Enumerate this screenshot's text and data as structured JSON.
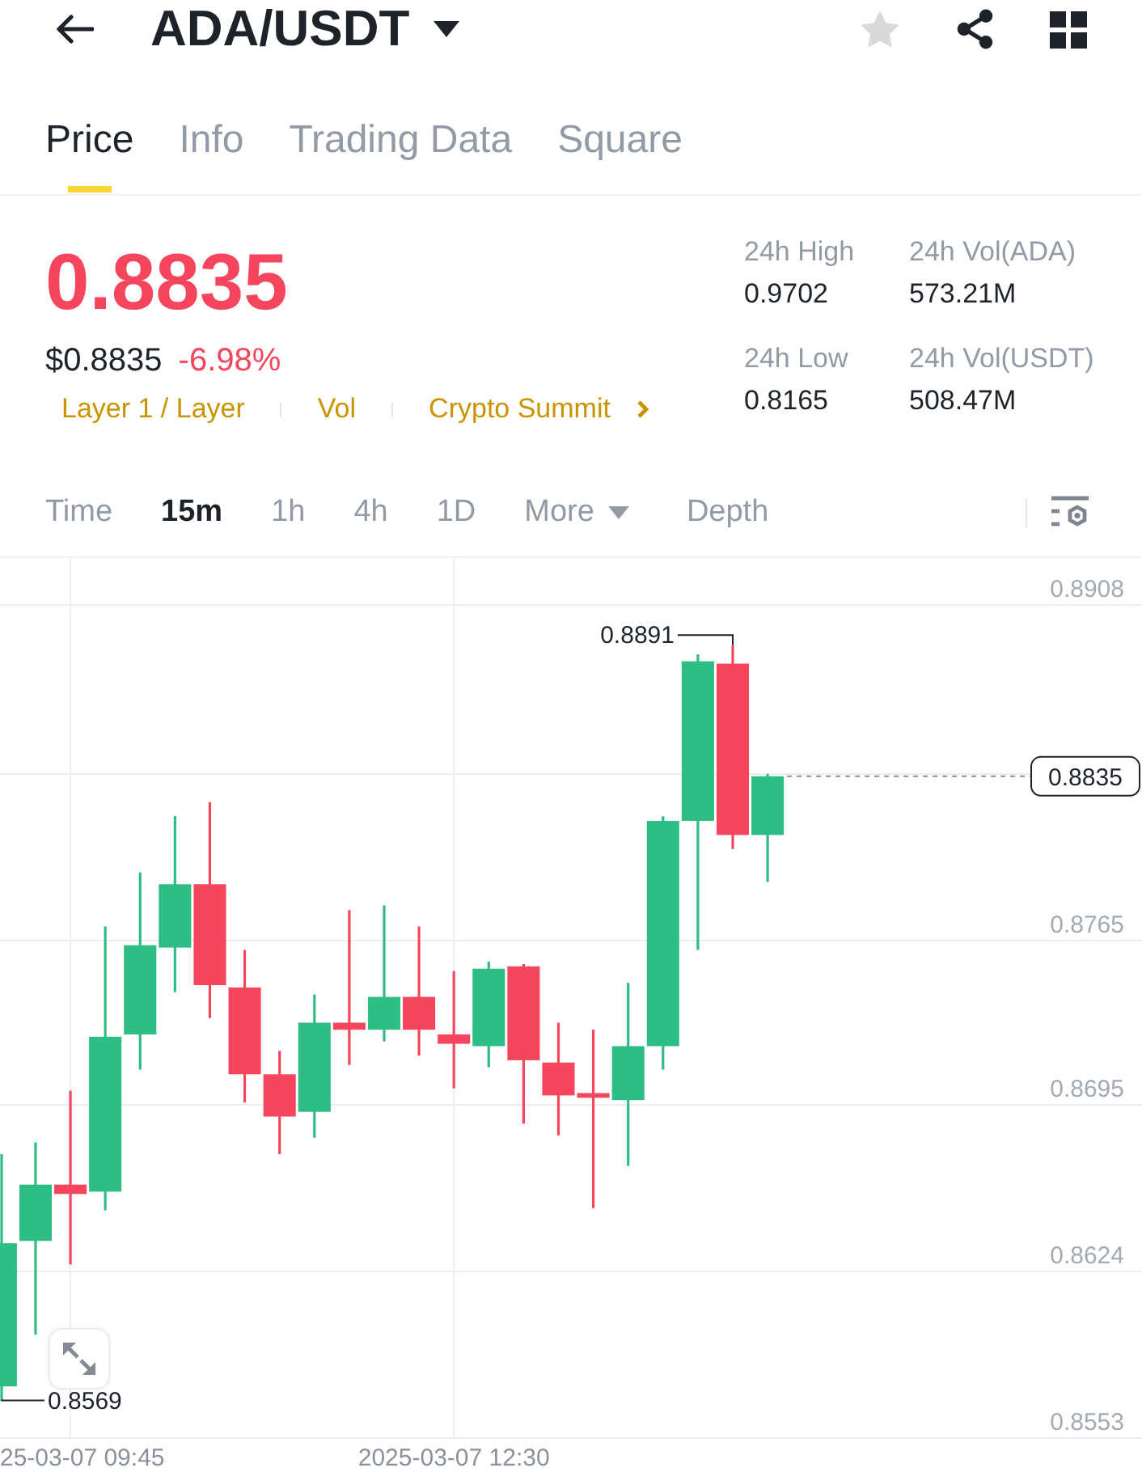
{
  "header": {
    "pair": "ADA/USDT",
    "favorite": false
  },
  "tabs": [
    {
      "label": "Price",
      "selected": true
    },
    {
      "label": "Info",
      "selected": false
    },
    {
      "label": "Trading Data",
      "selected": false
    },
    {
      "label": "Square",
      "selected": false
    }
  ],
  "ticker": {
    "last_price": "0.8835",
    "usd_price": "$0.8835",
    "change": "-6.98%",
    "price_down": true,
    "tags": [
      "Layer 1 / Layer",
      "Vol",
      "Crypto Summit"
    ],
    "stats": [
      {
        "label": "24h High",
        "value": "0.9702"
      },
      {
        "label": "24h Vol(ADA)",
        "value": "573.21M"
      },
      {
        "label": "24h Low",
        "value": "0.8165"
      },
      {
        "label": "24h Vol(USDT)",
        "value": "508.47M"
      }
    ]
  },
  "chart_toolbar": [
    {
      "label": "Time",
      "kind": "interval",
      "selected": false
    },
    {
      "label": "15m",
      "kind": "interval",
      "selected": true
    },
    {
      "label": "1h",
      "kind": "interval",
      "selected": false
    },
    {
      "label": "4h",
      "kind": "interval",
      "selected": false
    },
    {
      "label": "1D",
      "kind": "interval",
      "selected": false
    },
    {
      "label": "More",
      "kind": "dropdown",
      "selected": false
    },
    {
      "label": "Depth",
      "kind": "view",
      "selected": false
    }
  ],
  "chart": {
    "y_axis_labels": [
      "0.8908",
      "0.8765",
      "0.8695",
      "0.8624",
      "0.8553"
    ],
    "x_axis_labels": [
      "25-03-07 09:45",
      "2025-03-07 12:30"
    ],
    "high_label": "0.8891",
    "low_label": "0.8569",
    "price_marker": "0.8835"
  }
}
